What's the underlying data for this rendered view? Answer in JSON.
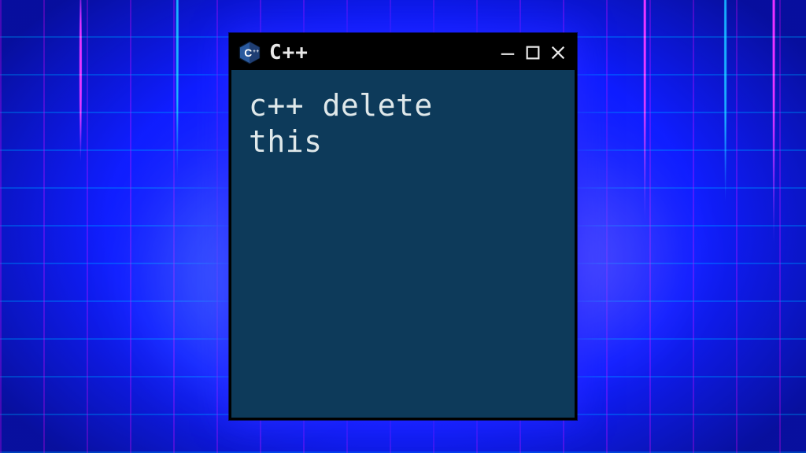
{
  "window": {
    "title": "C++",
    "icon": "cpp-hex-icon",
    "colors": {
      "titlebar": "#000000",
      "client_bg": "#0d3a5a",
      "text": "#e8e8e8"
    }
  },
  "content": {
    "text": "c++ delete\nthis"
  },
  "controls": {
    "minimize": "minimize-icon",
    "maximize": "maximize-icon",
    "close": "close-icon"
  }
}
